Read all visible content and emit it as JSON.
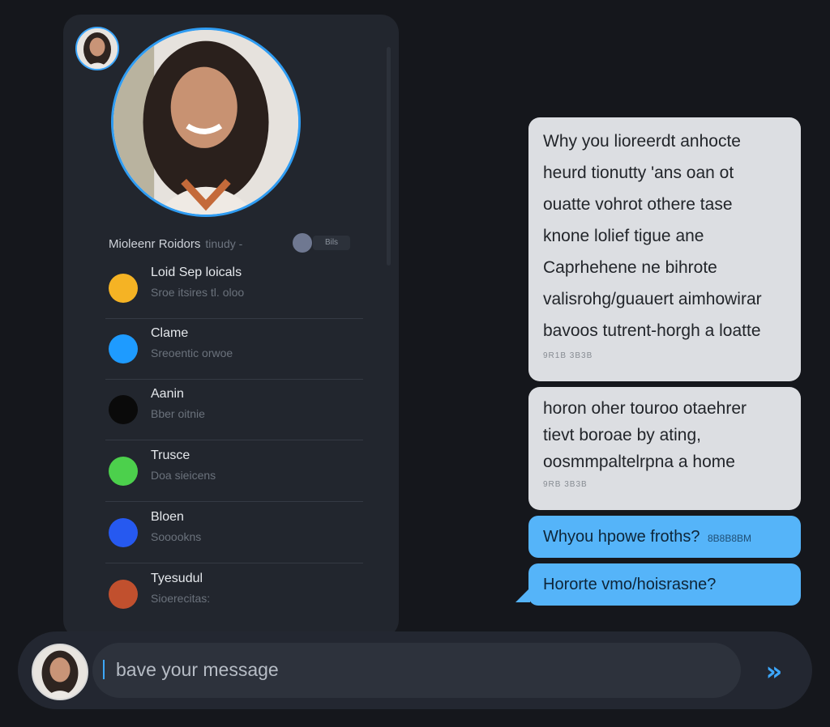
{
  "profile": {
    "name": "Mioleenr Roidors",
    "subtitle": "tinudy -",
    "status_pill": "Bils"
  },
  "contacts": [
    {
      "name": "Loid Sep loicals",
      "preview": "Sroe itsires tl. oloo",
      "color": "#f5b324"
    },
    {
      "name": "Clame",
      "preview": "Sreoentic orwoe",
      "color": "#1e9bff"
    },
    {
      "name": "Aanin",
      "preview": "Bber oitnie",
      "color": "#0a0a0a"
    },
    {
      "name": "Trusce",
      "preview": "Doa sieicens",
      "color": "#4cd04c"
    },
    {
      "name": "Bloen",
      "preview": "Sooookns",
      "color": "#2659f0"
    },
    {
      "name": "Tyesudul",
      "preview": "Sioerecitas:",
      "color": "#c1502e"
    }
  ],
  "messages": [
    {
      "lines": [
        "Why you lioreerdt anhocte",
        "heurd tionutty 'ans oan ot",
        "ouatte vohrot othere tase",
        "knone lolief tigue ane",
        "Caprhehene ne bihrote",
        "valisrohg/guauert aimhowirar",
        "bavoos tutrent-horgh a loatte"
      ],
      "time": "9R1B 3B3B"
    },
    {
      "lines": [
        "horon oher touroo otaehrer",
        "tievt boroae by ating,",
        "oosmmpaltelrpna a home"
      ],
      "time": "9RB 3B3B"
    }
  ],
  "replies": [
    {
      "text": "Whyou hpowe froths?",
      "time": "8B8B8BM"
    },
    {
      "text": "Hororte vmo/hoisrasne?"
    }
  ],
  "composer": {
    "placeholder": "bave your message",
    "send_icon": "double-chevron-right"
  }
}
